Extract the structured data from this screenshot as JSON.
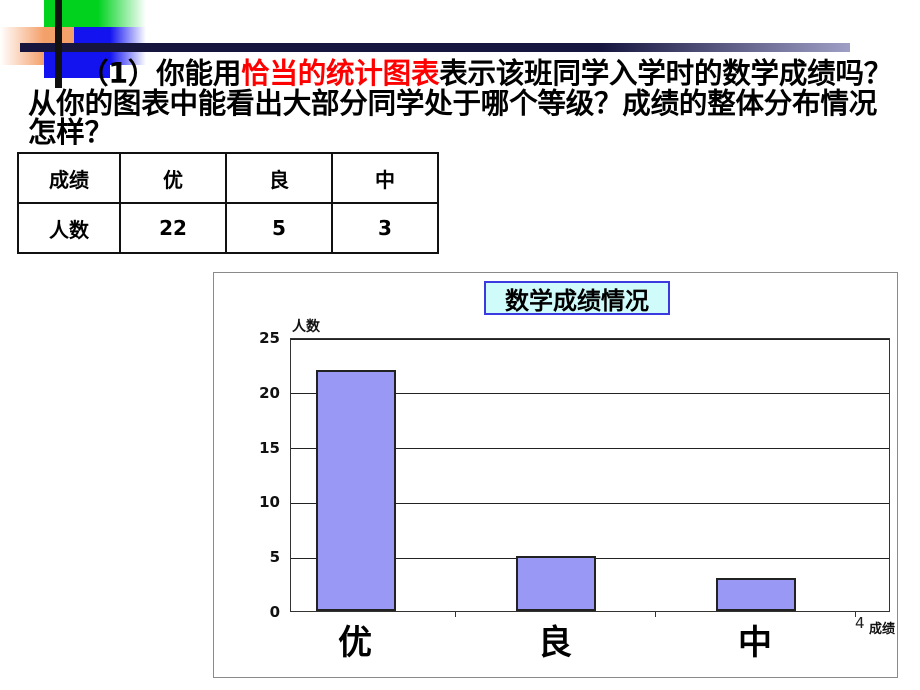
{
  "slide": {
    "page_number": "4"
  },
  "question": {
    "prefix": "（1）你能用",
    "highlight": "恰当的统计图表",
    "rest": "表示该班同学入学时的数学成绩吗？从你的图表中能看出大部分同学处于哪个等级？成绩的整体分布情况怎样？",
    "highlight_color": "#ff0000"
  },
  "table": {
    "header_row": [
      "成绩",
      "优",
      "良",
      "中"
    ],
    "value_row": [
      "人数",
      "22",
      "5",
      "3"
    ]
  },
  "chart_data": {
    "type": "bar",
    "title": "数学成绩情况",
    "categories": [
      "优",
      "良",
      "中"
    ],
    "values": [
      22,
      5,
      3
    ],
    "xlabel": "成绩",
    "ylabel": "人数",
    "ylim": [
      0,
      25
    ],
    "yticks": [
      "0",
      "5",
      "10",
      "15",
      "20",
      "25"
    ],
    "grid": true,
    "legend": "none",
    "bar_color": "#9999f5",
    "bar_border_color": "#222222",
    "title_box_fill": "#cffbfb",
    "title_box_border": "#3a3ae0"
  }
}
